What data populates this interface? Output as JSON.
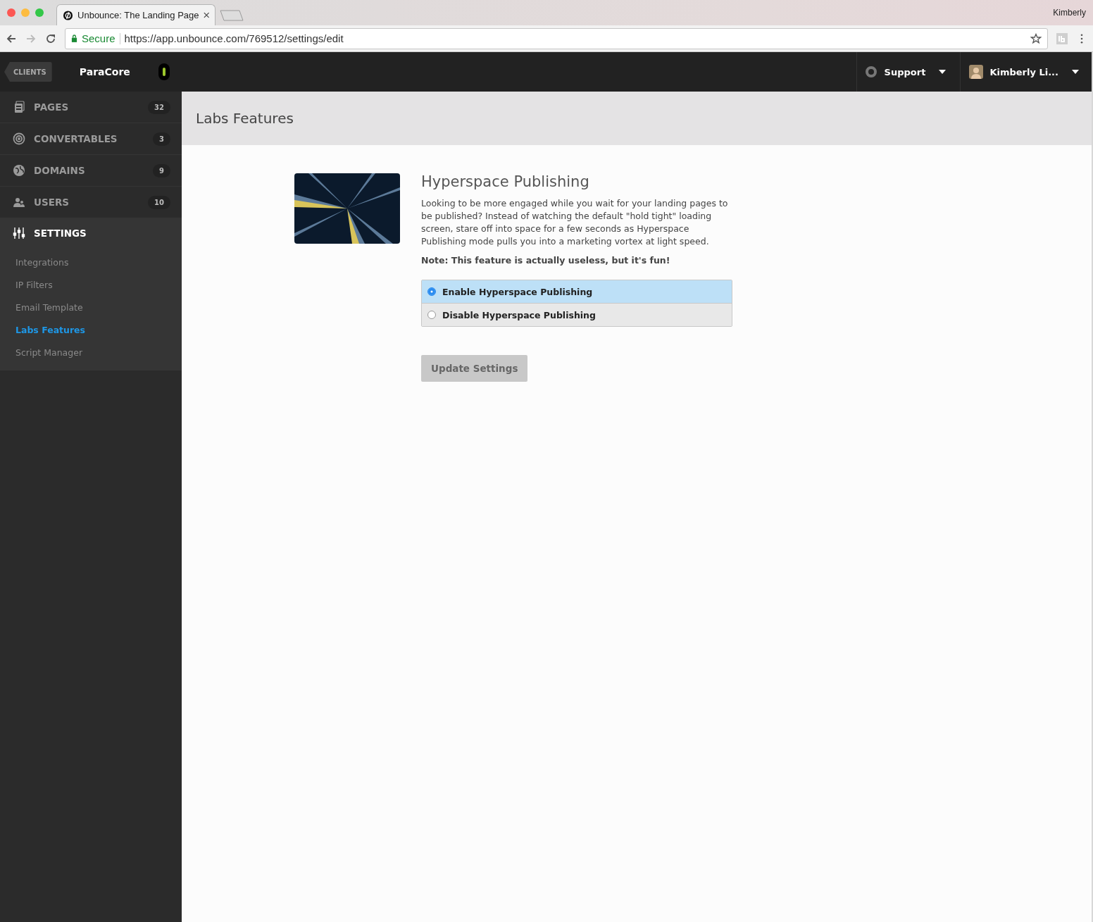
{
  "browser": {
    "tab_title": "Unbounce: The Landing Page",
    "profile": "Kimberly",
    "secure_label": "Secure",
    "url": "https://app.unbounce.com/769512/settings/edit"
  },
  "header": {
    "clients_label": "CLIENTS",
    "client_name": "ParaCore",
    "support_label": "Support",
    "user_name": "Kimberly Li..."
  },
  "sidebar": {
    "items": [
      {
        "label": "PAGES",
        "count": "32",
        "selected": false
      },
      {
        "label": "CONVERTABLES",
        "count": "3",
        "selected": false
      },
      {
        "label": "DOMAINS",
        "count": "9",
        "selected": false
      },
      {
        "label": "USERS",
        "count": "10",
        "selected": false
      },
      {
        "label": "SETTINGS",
        "selected": true,
        "children": [
          {
            "label": "Integrations",
            "selected": false
          },
          {
            "label": "IP Filters",
            "selected": false
          },
          {
            "label": "Email Template",
            "selected": false
          },
          {
            "label": "Labs Features",
            "selected": true
          },
          {
            "label": "Script Manager",
            "selected": false
          }
        ]
      }
    ]
  },
  "page": {
    "title": "Labs Features",
    "feature_title": "Hyperspace Publishing",
    "description": "Looking to be more engaged while you wait for your landing pages to be published? Instead of watching the default \"hold tight\" loading screen, stare off into space for a few seconds as Hyperspace Publishing mode pulls you into a marketing vortex at light speed.",
    "note": "Note: This feature is actually useless, but it's fun!",
    "options": [
      {
        "label": "Enable Hyperspace Publishing",
        "selected": true
      },
      {
        "label": "Disable Hyperspace Publishing",
        "selected": false
      }
    ],
    "submit_label": "Update Settings"
  }
}
